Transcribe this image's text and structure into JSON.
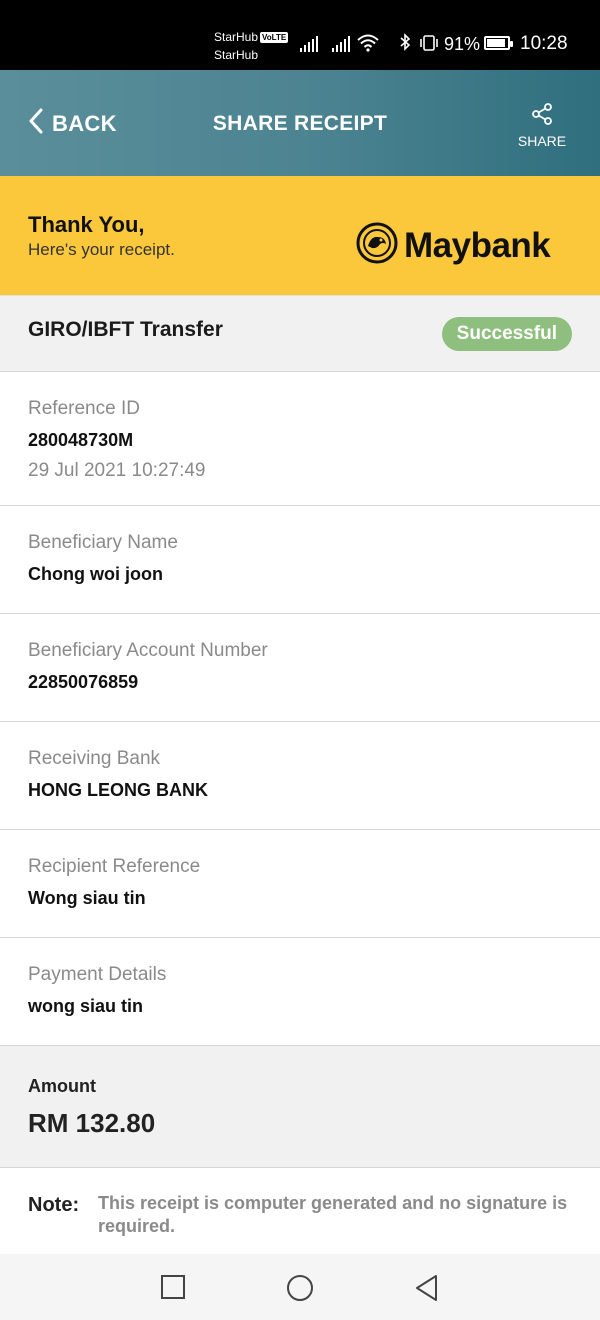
{
  "status_bar": {
    "carrier_1": "StarHub",
    "carrier_1_badge": "VoLTE",
    "carrier_2": "StarHub",
    "battery_percent": "91%",
    "battery_level": 0.91,
    "time": "10:28"
  },
  "header": {
    "back_label": "BACK",
    "title": "SHARE RECEIPT",
    "share_label": "SHARE"
  },
  "banner": {
    "thanks": "Thank You,",
    "subtitle": "Here's your receipt.",
    "brand": "Maybank",
    "brand_color": "#fcc83b"
  },
  "transfer": {
    "type": "GIRO/IBFT Transfer",
    "status": "Successful",
    "status_color": "#8fbf7f"
  },
  "details": {
    "reference_label": "Reference ID",
    "reference_value": "280048730M",
    "reference_datetime": "29 Jul 2021 10:27:49",
    "beneficiary_name_label": "Beneficiary Name",
    "beneficiary_name_value": "Chong woi joon",
    "beneficiary_account_label": "Beneficiary Account Number",
    "beneficiary_account_value": "22850076859",
    "receiving_bank_label": "Receiving Bank",
    "receiving_bank_value": "HONG LEONG BANK",
    "recipient_reference_label": "Recipient Reference",
    "recipient_reference_value": "Wong siau tin",
    "payment_details_label": "Payment Details",
    "payment_details_value": "wong siau tin"
  },
  "amount": {
    "label": "Amount",
    "value": "RM 132.80"
  },
  "note": {
    "label": "Note:",
    "text": "This receipt is computer generated and no signature is required."
  },
  "icons": {
    "back": "chevron-left-icon",
    "share": "share-icon",
    "logo": "maybank-tiger-icon",
    "nav_recent": "square-icon",
    "nav_home": "circle-icon",
    "nav_back": "triangle-back-icon"
  }
}
